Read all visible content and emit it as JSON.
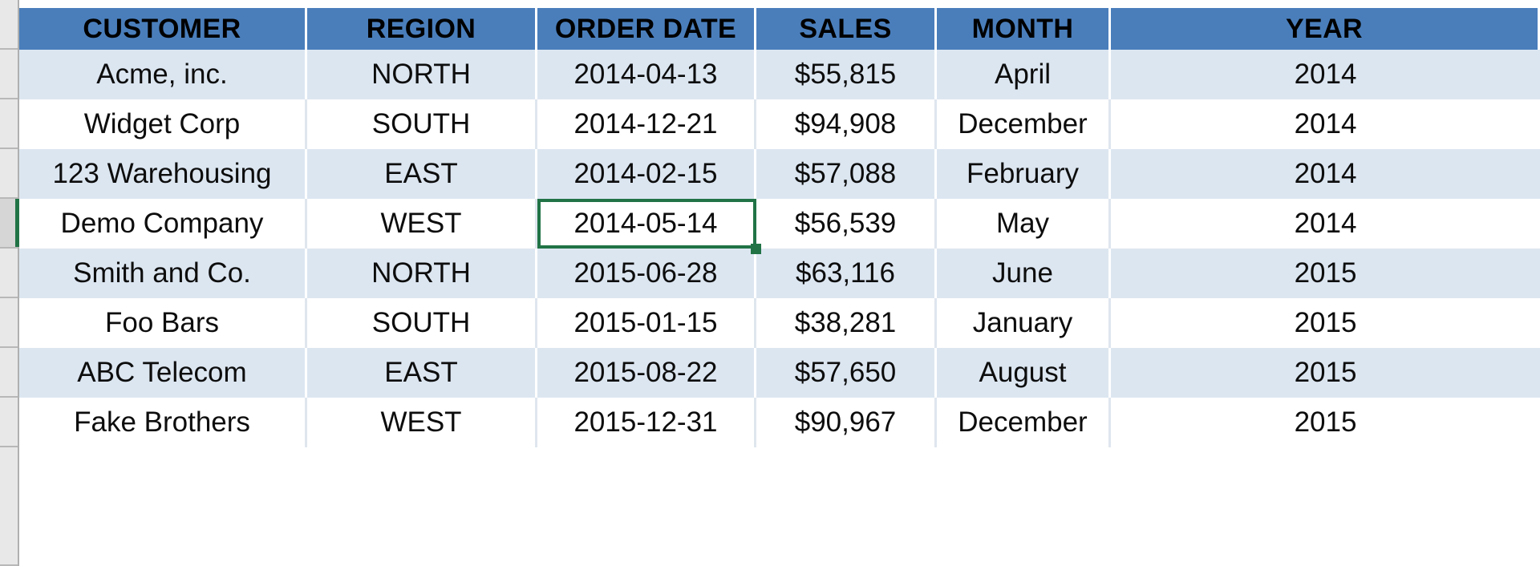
{
  "table": {
    "columns": [
      {
        "key": "customer",
        "label": "CUSTOMER"
      },
      {
        "key": "region",
        "label": "REGION"
      },
      {
        "key": "order_date",
        "label": "ORDER DATE"
      },
      {
        "key": "sales",
        "label": "SALES"
      },
      {
        "key": "month",
        "label": "MONTH"
      },
      {
        "key": "year",
        "label": "YEAR"
      }
    ],
    "rows": [
      {
        "customer": "Acme, inc.",
        "region": "NORTH",
        "order_date": "2014-04-13",
        "sales": "$55,815",
        "month": "April",
        "year": "2014"
      },
      {
        "customer": "Widget Corp",
        "region": "SOUTH",
        "order_date": "2014-12-21",
        "sales": "$94,908",
        "month": "December",
        "year": "2014"
      },
      {
        "customer": "123 Warehousing",
        "region": "EAST",
        "order_date": "2014-02-15",
        "sales": "$57,088",
        "month": "February",
        "year": "2014"
      },
      {
        "customer": "Demo Company",
        "region": "WEST",
        "order_date": "2014-05-14",
        "sales": "$56,539",
        "month": "May",
        "year": "2014"
      },
      {
        "customer": "Smith and Co.",
        "region": "NORTH",
        "order_date": "2015-06-28",
        "sales": "$63,116",
        "month": "June",
        "year": "2015"
      },
      {
        "customer": "Foo Bars",
        "region": "SOUTH",
        "order_date": "2015-01-15",
        "sales": "$38,281",
        "month": "January",
        "year": "2015"
      },
      {
        "customer": "ABC Telecom",
        "region": "EAST",
        "order_date": "2015-08-22",
        "sales": "$57,650",
        "month": "August",
        "year": "2015"
      },
      {
        "customer": "Fake Brothers",
        "region": "WEST",
        "order_date": "2015-12-31",
        "sales": "$90,967",
        "month": "December",
        "year": "2015"
      }
    ]
  },
  "selection": {
    "active_cell_value": "2014-05-14",
    "active_row_index": 3,
    "active_column_key": "order_date"
  },
  "colors": {
    "header_fill": "#4a7ebb",
    "band_fill": "#dce6f1",
    "plain_fill": "#ffffff",
    "selection_border": "#217346",
    "gutter_fill": "#e8e8e8"
  }
}
